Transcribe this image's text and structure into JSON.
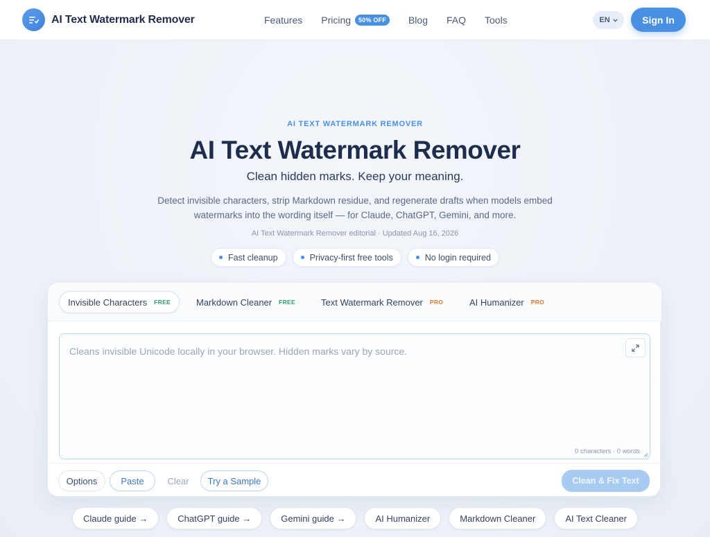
{
  "brand": {
    "name": "AI Text Watermark Remover"
  },
  "nav": {
    "links": [
      {
        "label": "Features"
      },
      {
        "label": "Pricing",
        "badge": "50% OFF"
      },
      {
        "label": "Blog"
      },
      {
        "label": "FAQ"
      },
      {
        "label": "Tools"
      }
    ],
    "language": "EN",
    "sign_in": "Sign In"
  },
  "hero": {
    "eyebrow": "AI TEXT WATERMARK REMOVER",
    "title": "AI Text Watermark Remover",
    "subtitle": "Clean hidden marks. Keep your meaning.",
    "description": "Detect invisible characters, strip Markdown residue, and regenerate drafts when models embed watermarks into the wording itself — for Claude, ChatGPT, Gemini, and more.",
    "byline": "AI Text Watermark Remover editorial · Updated Aug 16, 2026",
    "chips": [
      "Fast cleanup",
      "Privacy-first free tools",
      "No login required"
    ]
  },
  "tool": {
    "tabs": [
      {
        "label": "Invisible Characters",
        "tag": "FREE"
      },
      {
        "label": "Markdown Cleaner",
        "tag": "FREE"
      },
      {
        "label": "Text Watermark Remover",
        "tag": "PRO"
      },
      {
        "label": "AI Humanizer",
        "tag": "PRO"
      }
    ],
    "placeholder": "Cleans invisible Unicode locally in your browser. Hidden marks vary by source.",
    "counter": "0 characters · 0 words",
    "options": "Options",
    "paste": "Paste",
    "clear": "Clear",
    "sample": "Try a Sample",
    "clean": "Clean & Fix Text"
  },
  "guides": [
    "Claude guide →",
    "ChatGPT guide →",
    "Gemini guide →",
    "AI Humanizer",
    "Markdown Cleaner",
    "AI Text Cleaner"
  ],
  "colors": {
    "accent": "#4a90e2",
    "free": "#2a9d6b",
    "pro": "#d9782c",
    "text": "#1f2d4d"
  }
}
